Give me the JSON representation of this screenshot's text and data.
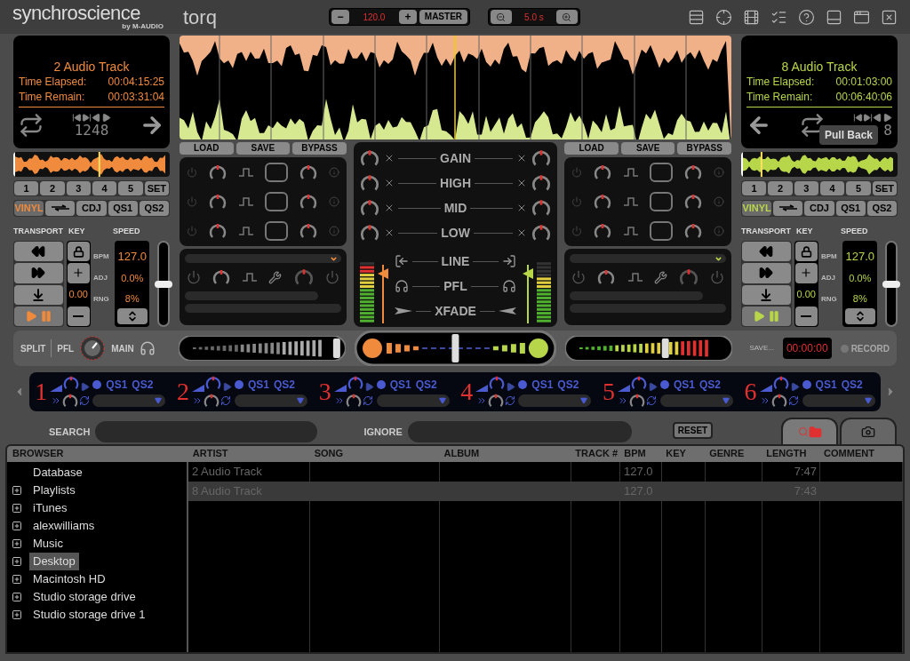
{
  "header": {
    "brand": "synchroscience",
    "brand_sub": "by M-AUDIO",
    "product": "torq",
    "tempo": {
      "minus": "−",
      "value": "120.0",
      "plus": "+",
      "master": "MASTER"
    },
    "zoom": {
      "value": "5.0 s"
    }
  },
  "decks": [
    {
      "kind": "left",
      "color": "#f08a3c",
      "track": "2 Audio Track",
      "elapsed_label": "Time Elapsed:",
      "elapsed": "00:04:15:25",
      "remain_label": "Time Remain:",
      "remain": "00:03:31:04",
      "loop_sizes": "1248",
      "overview": {
        "level": 0.55
      },
      "hotcues": [
        "1",
        "2",
        "3",
        "4",
        "5",
        "SET"
      ],
      "modes": [
        {
          "kind": "text",
          "label": "VINYL",
          "selected": true
        },
        {
          "kind": "icon",
          "selected": false
        },
        {
          "kind": "text",
          "label": "CDJ",
          "selected": false
        },
        {
          "kind": "text",
          "label": "QS1",
          "selected": false
        },
        {
          "kind": "text",
          "label": "QS2",
          "selected": false
        }
      ],
      "transport_label": "TRANSPORT",
      "key_label": "KEY",
      "speed_label": "SPEED",
      "key_value": "0.00",
      "bpm_label": "BPM",
      "bpm": "127.0",
      "adj_label": "ADJ",
      "adj": "0.0%",
      "rng_label": "RNG",
      "rng": "8%",
      "pitch_slider": {
        "level": 0.5
      }
    },
    {
      "kind": "right",
      "color": "#b8d64a",
      "track": "8 Audio Track",
      "elapsed_label": "Time Elapsed:",
      "elapsed": "00:01:03:00",
      "remain_label": "Time Remain:",
      "remain": "00:06:40:06",
      "loop_sizes": "8",
      "tooltip": "Pull Back",
      "overview": {
        "level": 0.13
      },
      "hotcues": [
        "1",
        "2",
        "3",
        "4",
        "5",
        "SET"
      ],
      "modes": [
        {
          "kind": "text",
          "label": "VINYL",
          "selected": true
        },
        {
          "kind": "icon",
          "selected": false
        },
        {
          "kind": "text",
          "label": "CDJ",
          "selected": false
        },
        {
          "kind": "text",
          "label": "QS1",
          "selected": false
        },
        {
          "kind": "text",
          "label": "QS2",
          "selected": false
        }
      ],
      "transport_label": "TRANSPORT",
      "key_label": "KEY",
      "speed_label": "SPEED",
      "key_value": "0.00",
      "bpm_label": "BPM",
      "bpm": "127.0",
      "adj_label": "ADJ",
      "adj": "0.0%",
      "rng_label": "RNG",
      "rng": "8%",
      "pitch_slider": {
        "level": 0.5
      }
    }
  ],
  "fx_panels": [
    {
      "buttons": [
        "LOAD",
        "SAVE",
        "BYPASS"
      ]
    },
    {
      "buttons": [
        "LOAD",
        "SAVE",
        "BYPASS"
      ]
    }
  ],
  "mixer": {
    "eq": [
      "GAIN",
      "HIGH",
      "MID",
      "LOW"
    ],
    "line": "LINE",
    "pfl": "PFL",
    "xfade": "XFADE",
    "channels": [
      {
        "meter": {
          "level": 0.95
        },
        "fader": {
          "level": 0.85
        }
      },
      {
        "meter": {
          "level": 0.8
        },
        "fader": {
          "level": 0.85
        }
      }
    ]
  },
  "monitor": {
    "split": "SPLIT",
    "pfl": "PFL",
    "main": "MAIN"
  },
  "deck_faders": [
    {
      "level": 0.95
    },
    {
      "level": 0.6
    }
  ],
  "crossfader": {
    "level": 0.5
  },
  "recorder": {
    "save": "SAVE...",
    "time": "00:00:00",
    "record": "RECORD",
    "armed": false
  },
  "fx_slots": [
    {
      "number": "1",
      "qs1": "QS1",
      "qs2": "QS2"
    },
    {
      "number": "2",
      "qs1": "QS1",
      "qs2": "QS2"
    },
    {
      "number": "3",
      "qs1": "QS1",
      "qs2": "QS2"
    },
    {
      "number": "4",
      "qs1": "QS1",
      "qs2": "QS2"
    },
    {
      "number": "5",
      "qs1": "QS1",
      "qs2": "QS2"
    },
    {
      "number": "6",
      "qs1": "QS1",
      "qs2": "QS2"
    }
  ],
  "search": {
    "label": "SEARCH",
    "ignore_label": "IGNORE",
    "reset": "RESET"
  },
  "browser_tabs": [
    {
      "kind": "search",
      "selected": true
    },
    {
      "kind": "camera",
      "selected": false
    }
  ],
  "browser": {
    "title": "BROWSER",
    "items": [
      {
        "label": "Database",
        "expandable": false,
        "selected": false
      },
      {
        "label": "Playlists",
        "expandable": true,
        "selected": false
      },
      {
        "label": "iTunes",
        "expandable": true,
        "selected": false
      },
      {
        "label": "alexwilliams",
        "expandable": true,
        "selected": false
      },
      {
        "label": "Music",
        "expandable": true,
        "selected": false
      },
      {
        "label": "Desktop",
        "expandable": true,
        "selected": true
      },
      {
        "label": "Macintosh HD",
        "expandable": true,
        "selected": false
      },
      {
        "label": "Studio storage drive",
        "expandable": true,
        "selected": false
      },
      {
        "label": "Studio storage drive 1",
        "expandable": true,
        "selected": false
      }
    ]
  },
  "table": {
    "columns": [
      "ARTIST",
      "SONG",
      "ALBUM",
      "TRACK #",
      "BPM",
      "KEY",
      "GENRE",
      "LENGTH",
      "COMMENT"
    ],
    "rows": [
      {
        "selected": false,
        "cells": [
          "2 Audio Track",
          "",
          "",
          "",
          "127.0",
          "",
          "",
          "7:47",
          ""
        ]
      },
      {
        "selected": true,
        "cells": [
          "8 Audio Track",
          "",
          "",
          "",
          "127.0",
          "",
          "",
          "7:43",
          ""
        ]
      }
    ]
  }
}
